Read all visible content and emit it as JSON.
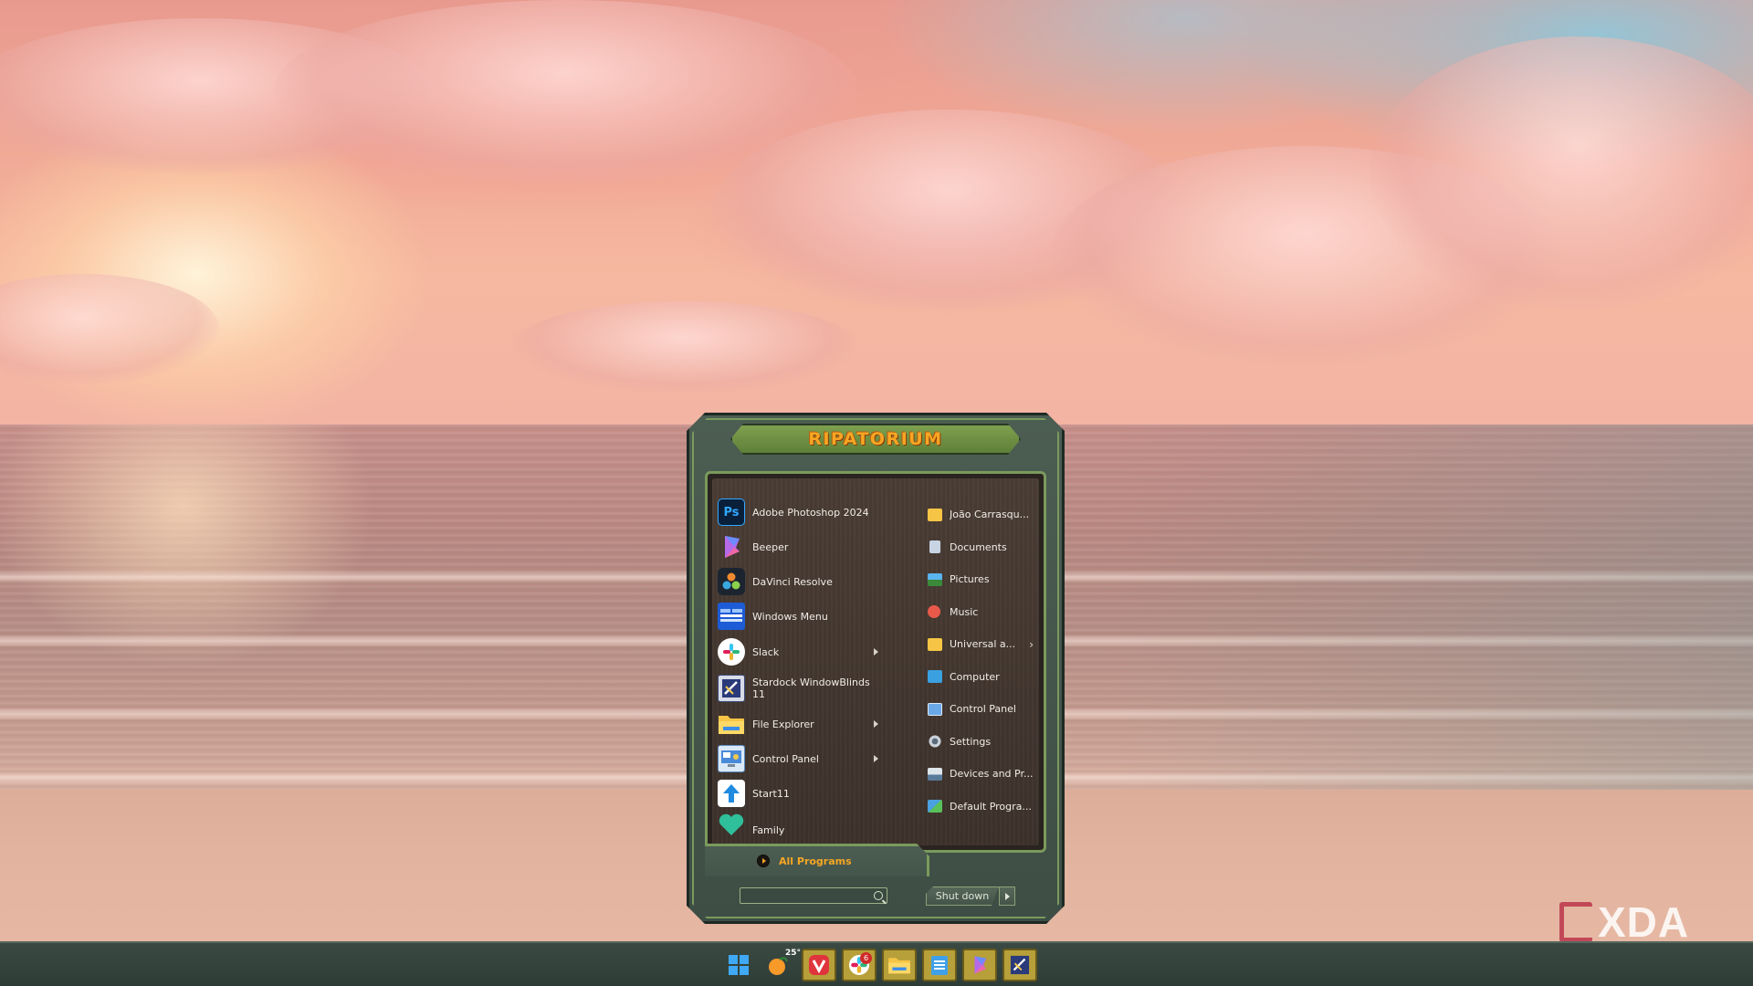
{
  "start_menu": {
    "title": "RIPATORIUM",
    "apps": [
      {
        "label": "Adobe Photoshop 2024",
        "icon": "photoshop-icon",
        "icon_text": "Ps",
        "has_submenu": false
      },
      {
        "label": "Beeper",
        "icon": "beeper-icon",
        "icon_text": "",
        "has_submenu": false
      },
      {
        "label": "DaVinci Resolve",
        "icon": "davinci-resolve-icon",
        "icon_text": "",
        "has_submenu": false
      },
      {
        "label": "Windows Menu",
        "icon": "windows-menu-icon",
        "icon_text": "",
        "has_submenu": false
      },
      {
        "label": "Slack",
        "icon": "slack-icon",
        "icon_text": "",
        "has_submenu": true
      },
      {
        "label": "Stardock WindowBlinds 11",
        "icon": "windowblinds-icon",
        "icon_text": "",
        "has_submenu": false
      },
      {
        "label": "File Explorer",
        "icon": "folder-icon",
        "icon_text": "",
        "has_submenu": true
      },
      {
        "label": "Control Panel",
        "icon": "control-panel-icon",
        "icon_text": "",
        "has_submenu": true
      },
      {
        "label": "Start11",
        "icon": "start11-icon",
        "icon_text": "",
        "has_submenu": false
      },
      {
        "label": "Family",
        "icon": "family-heart-icon",
        "icon_text": "",
        "has_submenu": false
      }
    ],
    "places": [
      {
        "label": "João Carrasqu...",
        "icon": "user-folder-icon",
        "has_submenu": false
      },
      {
        "label": "Documents",
        "icon": "documents-icon",
        "has_submenu": false
      },
      {
        "label": "Pictures",
        "icon": "pictures-icon",
        "has_submenu": false
      },
      {
        "label": "Music",
        "icon": "music-icon",
        "has_submenu": false
      },
      {
        "label": "Universal a...",
        "icon": "folder-icon",
        "has_submenu": true
      },
      {
        "label": "Computer",
        "icon": "computer-icon",
        "has_submenu": false
      },
      {
        "label": "Control Panel",
        "icon": "control-panel-icon",
        "has_submenu": false
      },
      {
        "label": "Settings",
        "icon": "gear-icon",
        "has_submenu": false
      },
      {
        "label": "Devices and Pr...",
        "icon": "devices-printers-icon",
        "has_submenu": false
      },
      {
        "label": "Default Progra...",
        "icon": "default-programs-icon",
        "has_submenu": false
      }
    ],
    "all_programs_label": "All Programs",
    "search_placeholder": "",
    "shutdown_label": "Shut down"
  },
  "taskbar": {
    "weather_temp": "25°",
    "slack_badge": "6",
    "items": [
      "windows-start-icon",
      "weather-icon",
      "vivaldi-icon",
      "slack-icon",
      "file-explorer-icon",
      "notepad-icon",
      "beeper-icon",
      "windowblinds-icon"
    ]
  },
  "watermark": "XDA",
  "colors": {
    "accent_orange": "#f6a623",
    "frame_green": "#7a9a5c",
    "taskbar": "#2e3c36"
  }
}
